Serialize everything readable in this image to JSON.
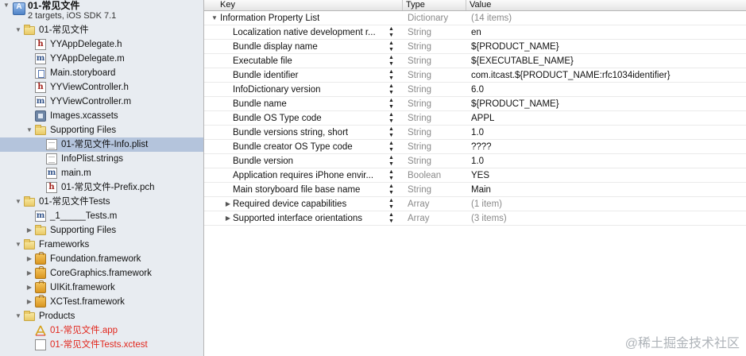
{
  "navigator": {
    "project": {
      "title": "01-常见文件",
      "subtitle": "2 targets, iOS SDK 7.1",
      "icon": "xcode-project-icon"
    },
    "items": [
      {
        "label": "01-常见文件",
        "icon": "folder-icon",
        "level": 1,
        "expanded": true,
        "red": false,
        "selected": false
      },
      {
        "label": "YYAppDelegate.h",
        "icon": "header-file-icon",
        "level": 2,
        "expanded": null,
        "red": false,
        "selected": false
      },
      {
        "label": "YYAppDelegate.m",
        "icon": "implementation-file-icon",
        "level": 2,
        "expanded": null,
        "red": false,
        "selected": false
      },
      {
        "label": "Main.storyboard",
        "icon": "storyboard-file-icon",
        "level": 2,
        "expanded": null,
        "red": false,
        "selected": false
      },
      {
        "label": "YYViewController.h",
        "icon": "header-file-icon",
        "level": 2,
        "expanded": null,
        "red": false,
        "selected": false
      },
      {
        "label": "YYViewController.m",
        "icon": "implementation-file-icon",
        "level": 2,
        "expanded": null,
        "red": false,
        "selected": false
      },
      {
        "label": "Images.xcassets",
        "icon": "asset-catalog-icon",
        "level": 2,
        "expanded": null,
        "red": false,
        "selected": false
      },
      {
        "label": "Supporting Files",
        "icon": "folder-icon",
        "level": 2,
        "expanded": true,
        "red": false,
        "selected": false
      },
      {
        "label": "01-常见文件-Info.plist",
        "icon": "plist-file-icon",
        "level": 3,
        "expanded": null,
        "red": false,
        "selected": true
      },
      {
        "label": "InfoPlist.strings",
        "icon": "strings-file-icon",
        "level": 3,
        "expanded": null,
        "red": false,
        "selected": false
      },
      {
        "label": "main.m",
        "icon": "implementation-file-icon",
        "level": 3,
        "expanded": null,
        "red": false,
        "selected": false
      },
      {
        "label": "01-常见文件-Prefix.pch",
        "icon": "header-file-icon",
        "level": 3,
        "expanded": null,
        "red": false,
        "selected": false
      },
      {
        "label": "01-常见文件Tests",
        "icon": "folder-icon",
        "level": 1,
        "expanded": true,
        "red": false,
        "selected": false
      },
      {
        "label": "_1_____Tests.m",
        "icon": "implementation-file-icon",
        "level": 2,
        "expanded": null,
        "red": false,
        "selected": false
      },
      {
        "label": "Supporting Files",
        "icon": "folder-icon",
        "level": 2,
        "expanded": false,
        "red": false,
        "selected": false
      },
      {
        "label": "Frameworks",
        "icon": "folder-icon",
        "level": 1,
        "expanded": true,
        "red": false,
        "selected": false
      },
      {
        "label": "Foundation.framework",
        "icon": "framework-icon",
        "level": 2,
        "expanded": false,
        "red": false,
        "selected": false
      },
      {
        "label": "CoreGraphics.framework",
        "icon": "framework-icon",
        "level": 2,
        "expanded": false,
        "red": false,
        "selected": false
      },
      {
        "label": "UIKit.framework",
        "icon": "framework-icon",
        "level": 2,
        "expanded": false,
        "red": false,
        "selected": false
      },
      {
        "label": "XCTest.framework",
        "icon": "framework-icon",
        "level": 2,
        "expanded": false,
        "red": false,
        "selected": false
      },
      {
        "label": "Products",
        "icon": "folder-icon",
        "level": 1,
        "expanded": true,
        "red": false,
        "selected": false
      },
      {
        "label": "01-常见文件.app",
        "icon": "app-product-icon",
        "level": 2,
        "expanded": null,
        "red": true,
        "selected": false
      },
      {
        "label": "01-常见文件Tests.xctest",
        "icon": "xctest-bundle-icon",
        "level": 2,
        "expanded": null,
        "red": true,
        "selected": false
      }
    ]
  },
  "plist": {
    "columns": {
      "key": "Key",
      "type": "Type",
      "value": "Value"
    },
    "root": {
      "key": "Information Property List",
      "type": "Dictionary",
      "value": "(14 items)"
    },
    "rows": [
      {
        "key": "Localization native development r...",
        "type": "String",
        "value": "en",
        "disclosure": false,
        "value_gray": false
      },
      {
        "key": "Bundle display name",
        "type": "String",
        "value": "${PRODUCT_NAME}",
        "disclosure": false,
        "value_gray": false
      },
      {
        "key": "Executable file",
        "type": "String",
        "value": "${EXECUTABLE_NAME}",
        "disclosure": false,
        "value_gray": false
      },
      {
        "key": "Bundle identifier",
        "type": "String",
        "value": "com.itcast.${PRODUCT_NAME:rfc1034identifier}",
        "disclosure": false,
        "value_gray": false
      },
      {
        "key": "InfoDictionary version",
        "type": "String",
        "value": "6.0",
        "disclosure": false,
        "value_gray": false
      },
      {
        "key": "Bundle name",
        "type": "String",
        "value": "${PRODUCT_NAME}",
        "disclosure": false,
        "value_gray": false
      },
      {
        "key": "Bundle OS Type code",
        "type": "String",
        "value": "APPL",
        "disclosure": false,
        "value_gray": false
      },
      {
        "key": "Bundle versions string, short",
        "type": "String",
        "value": "1.0",
        "disclosure": false,
        "value_gray": false
      },
      {
        "key": "Bundle creator OS Type code",
        "type": "String",
        "value": "????",
        "disclosure": false,
        "value_gray": false
      },
      {
        "key": "Bundle version",
        "type": "String",
        "value": "1.0",
        "disclosure": false,
        "value_gray": false
      },
      {
        "key": "Application requires iPhone envir...",
        "type": "Boolean",
        "value": "YES",
        "disclosure": false,
        "value_gray": false
      },
      {
        "key": "Main storyboard file base name",
        "type": "String",
        "value": "Main",
        "disclosure": false,
        "value_gray": false
      },
      {
        "key": "Required device capabilities",
        "type": "Array",
        "value": "(1 item)",
        "disclosure": true,
        "value_gray": true
      },
      {
        "key": "Supported interface orientations",
        "type": "Array",
        "value": "(3 items)",
        "disclosure": true,
        "value_gray": true
      }
    ]
  },
  "watermark": "@稀土掘金技术社区"
}
